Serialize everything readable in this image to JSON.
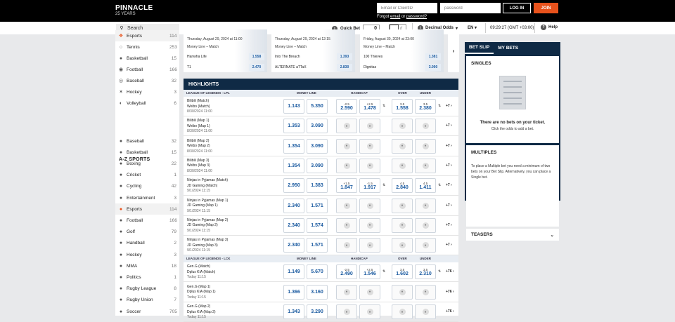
{
  "header": {
    "logo": "PINNACLE",
    "logo_sub": "25 YEARS",
    "email_placeholder": "Email or ClientID",
    "password_placeholder": "password",
    "login_label": "LOG IN",
    "join_label": "JOIN",
    "forgot_prefix": "Forgot",
    "forgot_email": "email",
    "forgot_or": "or",
    "forgot_password": "password?"
  },
  "toolbar": {
    "search_placeholder": "Search",
    "quick_bet_label": "Quick Bet",
    "quick_bet_value": "0",
    "odds_format": "Decimal Odds",
    "language": "EN",
    "time": "09:29:27 (GMT +03:00)",
    "help": "Help"
  },
  "sidebar": {
    "top_items": [
      {
        "label": "Esports",
        "count": "114",
        "icon": "gamepad-icon",
        "active": true
      },
      {
        "label": "Tennis",
        "count": "253",
        "icon": "tennis-icon"
      },
      {
        "label": "Basketball",
        "count": "15",
        "icon": "basketball-icon"
      },
      {
        "label": "Football",
        "count": "166",
        "icon": "football-icon"
      },
      {
        "label": "Baseball",
        "count": "32",
        "icon": "baseball-icon"
      },
      {
        "label": "Hockey",
        "count": "3",
        "icon": "hockey-icon"
      },
      {
        "label": "Volleyball",
        "count": "6",
        "icon": "volleyball-icon"
      }
    ],
    "az_heading": "A-Z SPORTS",
    "az_items": [
      {
        "label": "Baseball",
        "count": "32"
      },
      {
        "label": "Basketball",
        "count": "15"
      },
      {
        "label": "Boxing",
        "count": "22"
      },
      {
        "label": "Cricket",
        "count": "1"
      },
      {
        "label": "Cycling",
        "count": "42"
      },
      {
        "label": "Entertainment",
        "count": "3"
      },
      {
        "label": "Esports",
        "count": "114",
        "active": true
      },
      {
        "label": "Football",
        "count": "166"
      },
      {
        "label": "Golf",
        "count": "79"
      },
      {
        "label": "Handball",
        "count": "2"
      },
      {
        "label": "Hockey",
        "count": "3"
      },
      {
        "label": "MMA",
        "count": "18"
      },
      {
        "label": "Politics",
        "count": "1"
      },
      {
        "label": "Rugby League",
        "count": "8"
      },
      {
        "label": "Rugby Union",
        "count": "7"
      },
      {
        "label": "Soccer",
        "count": "705"
      }
    ]
  },
  "featured": [
    {
      "date": "Thursday, August 29, 2024 at 11:00",
      "market": "Money Line – Match",
      "team1": "Hanwha Life",
      "odd1": "1.558",
      "team2": "T1",
      "odd2": "2.470"
    },
    {
      "date": "Thursday, August 29, 2024 at 12:15",
      "market": "Money Line – Match",
      "team1": "Into The Breach",
      "odd1": "1.393",
      "team2": "ALTERNATE aTTaX",
      "odd2": "2.830"
    },
    {
      "date": "Friday, August 30, 2024 at 23:00",
      "market": "Money Line – Match",
      "team1": "100 Thieves",
      "odd1": "1.381",
      "team2": "Dignitas",
      "odd2": "3.090"
    }
  ],
  "highlights": {
    "title": "HIGHLIGHTS",
    "col_moneyline": "MONEY LINE",
    "col_handicap": "HANDICAP",
    "col_over": "OVER",
    "col_under": "UNDER",
    "leagues": [
      {
        "name": "LEAGUE OF LEGENDS - LPL",
        "events": [
          {
            "t1": "Bilibili (Match)",
            "t2": "Weibo (Match)",
            "date": "8/30/2024 11:00",
            "ml1": "1.143",
            "ml2": "5.350",
            "h1": "-2.5",
            "h1o": "2.590",
            "h2": "+2.5",
            "h2o": "1.478",
            "ov": "3.5",
            "ovo": "1.558",
            "un": "3.5",
            "uno": "2.380",
            "more": "+7"
          },
          {
            "t1": "Bilibili (Map 1)",
            "t2": "Weibo (Map 1)",
            "date": "8/30/2024 11:00",
            "ml1": "1.353",
            "ml2": "3.090",
            "more": "+7"
          },
          {
            "t1": "Bilibili (Map 2)",
            "t2": "Weibo (Map 2)",
            "date": "8/30/2024 11:00",
            "ml1": "1.354",
            "ml2": "3.090",
            "more": "+7"
          },
          {
            "t1": "Bilibili (Map 3)",
            "t2": "Weibo (Map 3)",
            "date": "8/30/2024 11:00",
            "ml1": "1.354",
            "ml2": "3.090",
            "more": "+7"
          },
          {
            "t1": "Ninjas in Pyjamas (Match)",
            "t2": "JD Gaming (Match)",
            "date": "9/1/2024 11:15",
            "ml1": "2.950",
            "ml2": "1.383",
            "h1": "+1.5",
            "h1o": "1.847",
            "h2": "-1.5",
            "h2o": "1.917",
            "ov": "4.5",
            "ovo": "2.840",
            "un": "4.5",
            "uno": "1.411",
            "more": "+7"
          },
          {
            "t1": "Ninjas in Pyjamas (Map 1)",
            "t2": "JD Gaming (Map 1)",
            "date": "9/1/2024 11:15",
            "ml1": "2.340",
            "ml2": "1.571",
            "more": "+7"
          },
          {
            "t1": "Ninjas in Pyjamas (Map 2)",
            "t2": "JD Gaming (Map 2)",
            "date": "9/1/2024 11:15",
            "ml1": "2.340",
            "ml2": "1.574",
            "more": "+7"
          },
          {
            "t1": "Ninjas in Pyjamas (Map 3)",
            "t2": "JD Gaming (Map 3)",
            "date": "9/1/2024 11:15",
            "ml1": "2.340",
            "ml2": "1.571",
            "more": "+7"
          }
        ]
      },
      {
        "name": "LEAGUE OF LEGENDS - LCK",
        "events": [
          {
            "t1": "Gen.G (Match)",
            "t2": "Dplus KIA (Match)",
            "date": "Today 11:15",
            "ml1": "1.149",
            "ml2": "5.670",
            "h1": "-2.5",
            "h1o": "2.490",
            "h2": "+2.5",
            "h2o": "1.546",
            "ov": "3.5",
            "ovo": "1.602",
            "un": "3.5",
            "uno": "2.310",
            "more": "+76"
          },
          {
            "t1": "Gen.G (Map 1)",
            "t2": "Dplus KIA (Map 1)",
            "date": "Today 11:15",
            "ml1": "1.366",
            "ml2": "3.160",
            "more": "+76"
          },
          {
            "t1": "Gen.G (Map 2)",
            "t2": "Dplus KIA (Map 2)",
            "date": "Today 11:15",
            "ml1": "1.343",
            "ml2": "3.290",
            "more": "+76"
          }
        ]
      }
    ]
  },
  "betslip": {
    "tab_betslip": "BET SLIP",
    "tab_mybets": "MY BETS",
    "singles": "SINGLES",
    "empty_title": "There are no bets on your ticket.",
    "empty_sub": "Click the odds to add a bet.",
    "multiples": "MULTIPLES",
    "multiples_text": "To place a Multiple bet you need a minimum of two bets on your Bet Slip. Alternatively, you can place a Single bet.",
    "teasers": "TEASERS"
  }
}
